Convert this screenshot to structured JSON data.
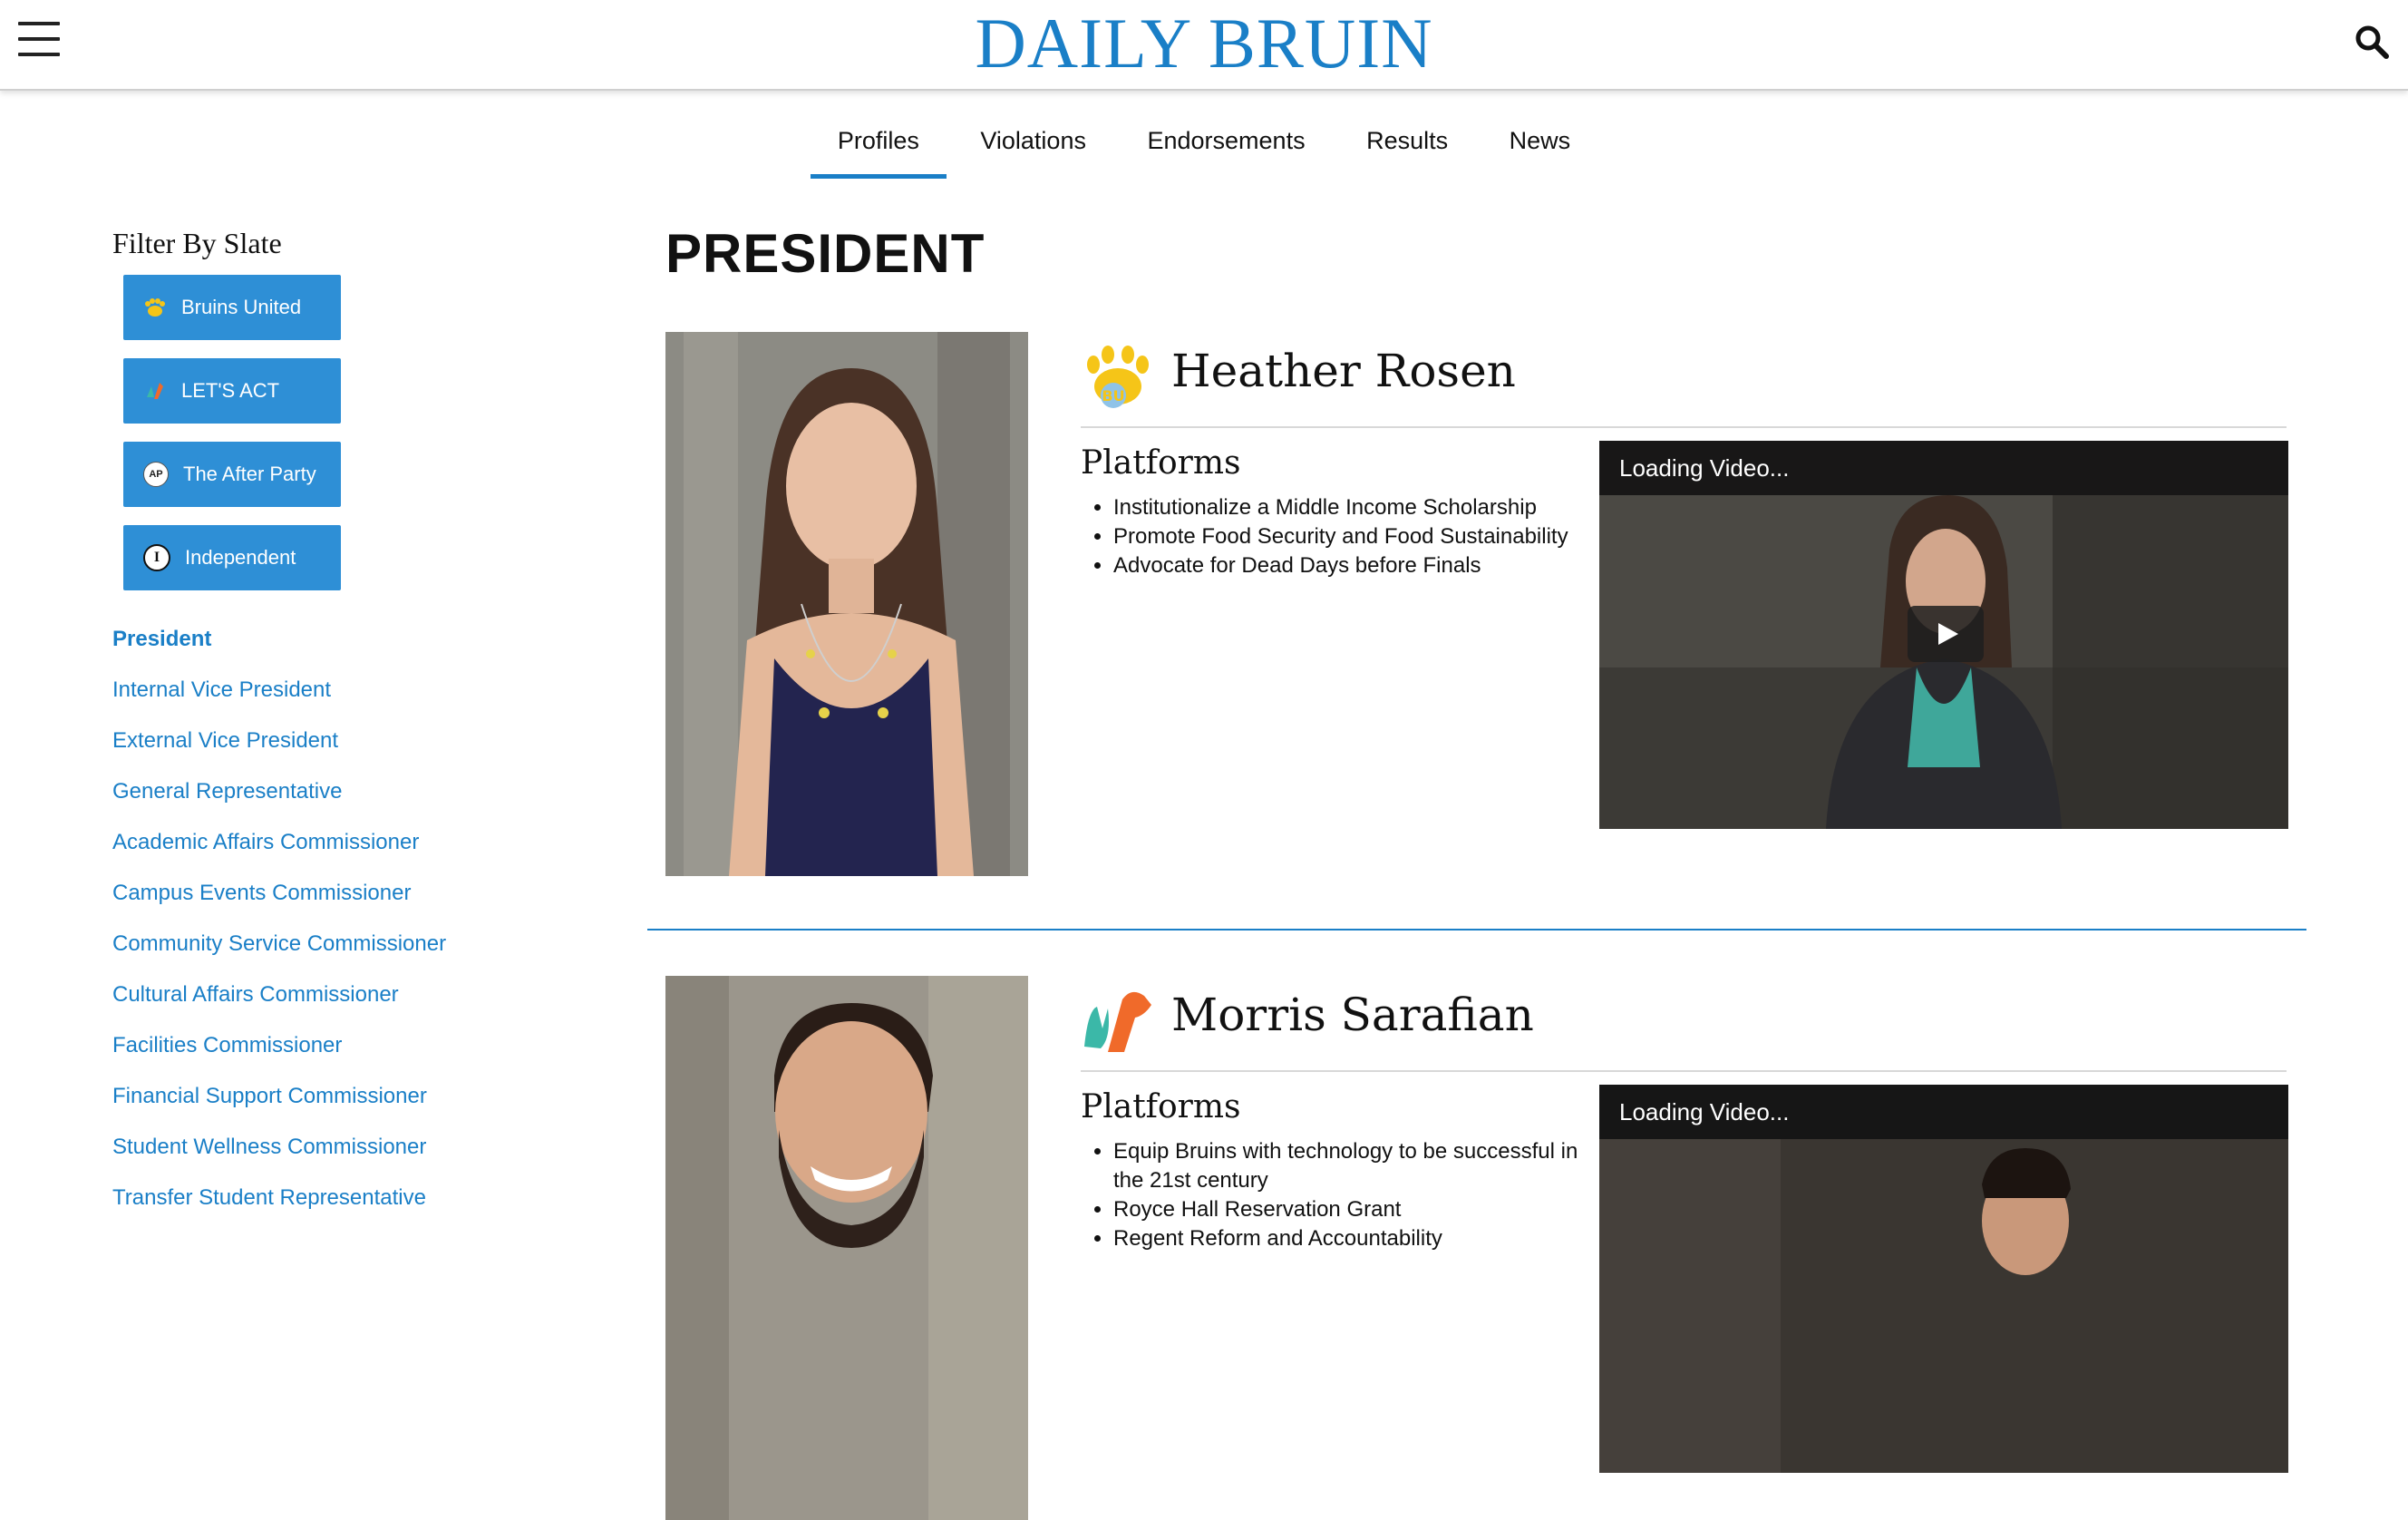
{
  "header": {
    "logo": "DAILY BRUIN",
    "menu_icon": "hamburger-menu-icon",
    "search_icon": "search-icon"
  },
  "tabs": [
    {
      "label": "Profiles",
      "active": true
    },
    {
      "label": "Violations",
      "active": false
    },
    {
      "label": "Endorsements",
      "active": false
    },
    {
      "label": "Results",
      "active": false
    },
    {
      "label": "News",
      "active": false
    }
  ],
  "sidebar": {
    "filter_title": "Filter By Slate",
    "slates": [
      {
        "label": "Bruins United",
        "icon": "bear-paw-icon"
      },
      {
        "label": "LET'S ACT",
        "icon": "lets-act-icon"
      },
      {
        "label": "The After Party",
        "icon": "ap-icon"
      },
      {
        "label": "Independent",
        "icon": "independent-icon"
      }
    ],
    "positions": [
      "President",
      "Internal Vice President",
      "External Vice President",
      "General Representative",
      "Academic Affairs Commissioner",
      "Campus Events Commissioner",
      "Community Service Commissioner",
      "Cultural Affairs Commissioner",
      "Facilities Commissioner",
      "Financial Support Commissioner",
      "Student Wellness Commissioner",
      "Transfer Student Representative"
    ],
    "active_position": "President"
  },
  "main": {
    "section_title": "PRESIDENT",
    "candidates": [
      {
        "name": "Heather Rosen",
        "slate_icon": "bear-paw-icon",
        "platforms_title": "Platforms",
        "platforms": [
          "Institutionalize a Middle Income Scholarship",
          "Promote Food Security and Food Sustainability",
          "Advocate for Dead Days before Finals"
        ],
        "video_status": "Loading Video..."
      },
      {
        "name": "Morris Sarafian",
        "slate_icon": "lets-act-icon",
        "platforms_title": "Platforms",
        "platforms": [
          "Equip Bruins with technology to be successful in the 21st century",
          "Royce Hall Reservation Grant",
          "Regent Reform and Accountability"
        ],
        "video_status": "Loading Video..."
      }
    ]
  },
  "colors": {
    "brand_blue": "#1a7fc7",
    "button_blue": "#2e8fd6"
  }
}
